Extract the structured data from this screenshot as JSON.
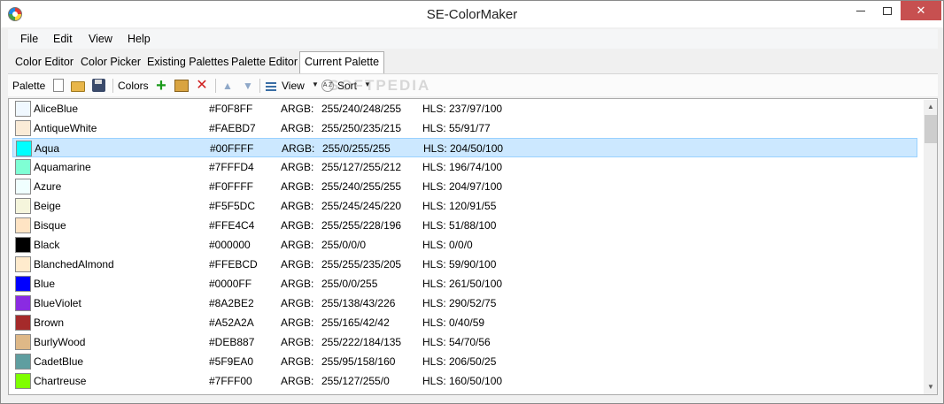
{
  "window": {
    "title": "SE-ColorMaker",
    "minimize_icon": "minimize-icon",
    "maximize_icon": "maximize-icon",
    "close_icon": "close-icon",
    "close_glyph": "✕"
  },
  "menu": [
    "File",
    "Edit",
    "View",
    "Help"
  ],
  "tabs": [
    "Color Editor",
    "Color Picker",
    "Existing Palettes",
    "Palette Editor",
    "Current Palette"
  ],
  "active_tab": "Current Palette",
  "toolbar": {
    "palette_label": "Palette",
    "colors_label": "Colors",
    "view_label": "View",
    "sort_label": "Sort",
    "sort_icon_text": "A Z",
    "icons": [
      "new-file-icon",
      "open-folder-icon",
      "save-icon",
      "add-icon",
      "edit-icon",
      "delete-icon",
      "move-up-icon",
      "move-down-icon",
      "view-grid-icon",
      "sort-icon"
    ]
  },
  "watermark": "SOFTPEDIA",
  "argb_label": "ARGB:",
  "selected_row": "Aqua",
  "colors": [
    {
      "name": "AliceBlue",
      "hex": "#F0F8FF",
      "argb": "255/240/248/255",
      "hls": "HLS: 237/97/100",
      "swatch": "#F0F8FF"
    },
    {
      "name": "AntiqueWhite",
      "hex": "#FAEBD7",
      "argb": "255/250/235/215",
      "hls": "HLS: 55/91/77",
      "swatch": "#FAEBD7"
    },
    {
      "name": "Aqua",
      "hex": "#00FFFF",
      "argb": "255/0/255/255",
      "hls": "HLS: 204/50/100",
      "swatch": "#00FFFF"
    },
    {
      "name": "Aquamarine",
      "hex": "#7FFFD4",
      "argb": "255/127/255/212",
      "hls": "HLS: 196/74/100",
      "swatch": "#7FFFD4"
    },
    {
      "name": "Azure",
      "hex": "#F0FFFF",
      "argb": "255/240/255/255",
      "hls": "HLS: 204/97/100",
      "swatch": "#F0FFFF"
    },
    {
      "name": "Beige",
      "hex": "#F5F5DC",
      "argb": "255/245/245/220",
      "hls": "HLS: 120/91/55",
      "swatch": "#F5F5DC"
    },
    {
      "name": "Bisque",
      "hex": "#FFE4C4",
      "argb": "255/255/228/196",
      "hls": "HLS: 51/88/100",
      "swatch": "#FFE4C4"
    },
    {
      "name": "Black",
      "hex": "#000000",
      "argb": "255/0/0/0",
      "hls": "HLS: 0/0/0",
      "swatch": "#000000"
    },
    {
      "name": "BlanchedAlmond",
      "hex": "#FFEBCD",
      "argb": "255/255/235/205",
      "hls": "HLS: 59/90/100",
      "swatch": "#FFEBCD"
    },
    {
      "name": "Blue",
      "hex": "#0000FF",
      "argb": "255/0/0/255",
      "hls": "HLS: 261/50/100",
      "swatch": "#0000FF"
    },
    {
      "name": "BlueViolet",
      "hex": "#8A2BE2",
      "argb": "255/138/43/226",
      "hls": "HLS: 290/52/75",
      "swatch": "#8A2BE2"
    },
    {
      "name": "Brown",
      "hex": "#A52A2A",
      "argb": "255/165/42/42",
      "hls": "HLS: 0/40/59",
      "swatch": "#A52A2A"
    },
    {
      "name": "BurlyWood",
      "hex": "#DEB887",
      "argb": "255/222/184/135",
      "hls": "HLS: 54/70/56",
      "swatch": "#DEB887"
    },
    {
      "name": "CadetBlue",
      "hex": "#5F9EA0",
      "argb": "255/95/158/160",
      "hls": "HLS: 206/50/25",
      "swatch": "#5F9EA0"
    },
    {
      "name": "Chartreuse",
      "hex": "#7FFF00",
      "argb": "255/127/255/0",
      "hls": "HLS: 160/50/100",
      "swatch": "#7FFF00"
    }
  ]
}
